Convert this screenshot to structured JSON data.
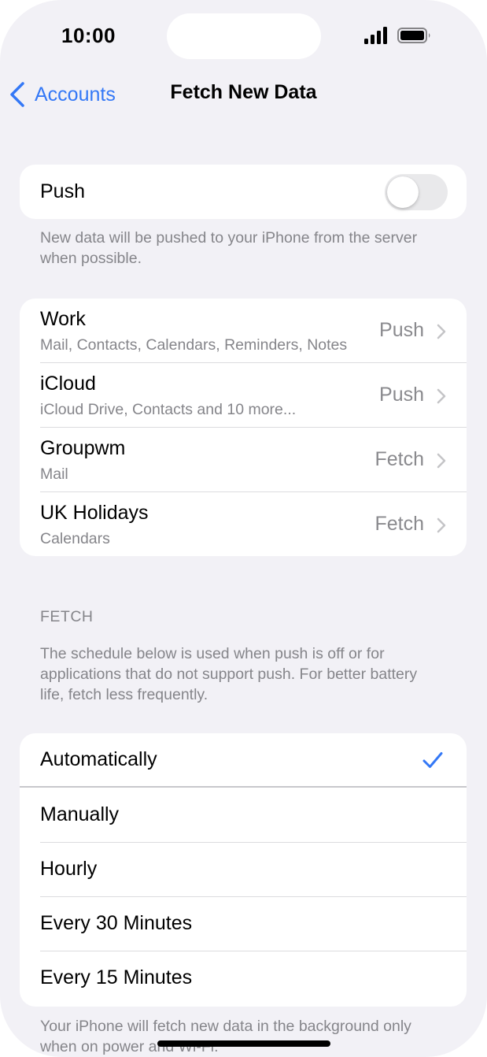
{
  "status_bar": {
    "time": "10:00",
    "signal_icon": "cellular-signal-icon",
    "battery_icon": "battery-icon"
  },
  "nav": {
    "back_label": "Accounts",
    "title": "Fetch New Data"
  },
  "push": {
    "label": "Push",
    "enabled": false,
    "footnote": "New data will be pushed to your iPhone from the server when possible."
  },
  "accounts": [
    {
      "name": "Work",
      "services": "Mail, Contacts, Calendars, Reminders, Notes",
      "mode": "Push"
    },
    {
      "name": "iCloud",
      "services": "iCloud Drive, Contacts and 10 more...",
      "mode": "Push"
    },
    {
      "name": "Groupwm",
      "services": "Mail",
      "mode": "Fetch"
    },
    {
      "name": "UK Holidays",
      "services": "Calendars",
      "mode": "Fetch"
    }
  ],
  "fetch": {
    "header": "FETCH",
    "description": "The schedule below is used when push is off or for applications that do not support push. For better battery life, fetch less frequently.",
    "options": [
      {
        "label": "Automatically",
        "selected": true
      },
      {
        "label": "Manually",
        "selected": false
      },
      {
        "label": "Hourly",
        "selected": false
      },
      {
        "label": "Every 30 Minutes",
        "selected": false
      },
      {
        "label": "Every 15 Minutes",
        "selected": false
      }
    ],
    "footer": "Your iPhone will fetch new data in the background only when on power and Wi-Fi."
  },
  "colors": {
    "accent": "#3478f6",
    "background": "#f2f1f6",
    "secondary_text": "#85858a"
  }
}
